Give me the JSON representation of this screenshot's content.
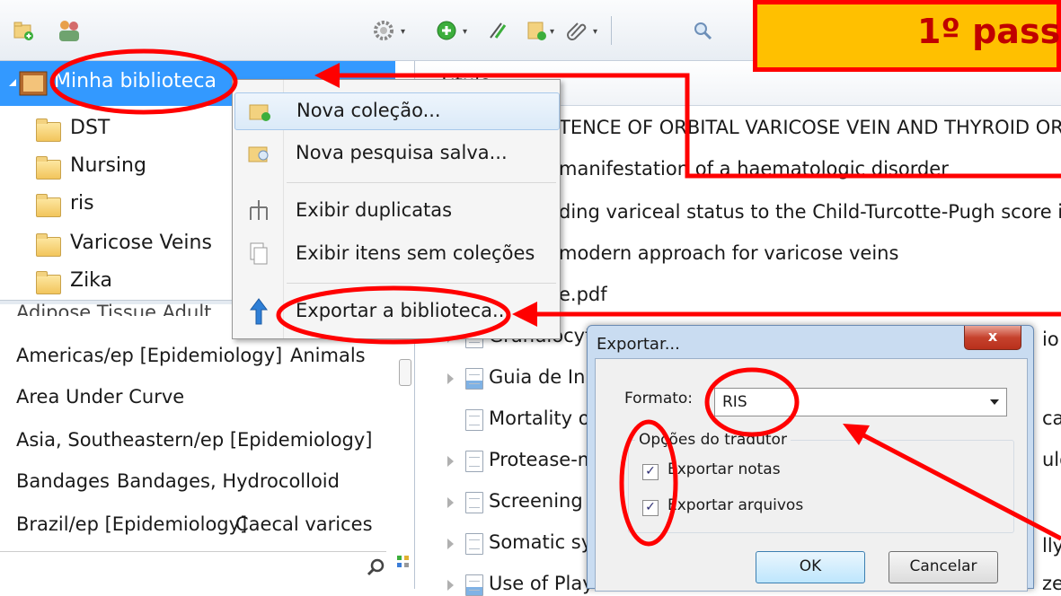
{
  "toolbar": {
    "icons": [
      "new-collection-icon",
      "new-group-icon",
      "actions-gear-icon",
      "add-item-icon",
      "add-by-identifier-icon",
      "new-note-icon",
      "attachment-icon",
      "search-icon"
    ]
  },
  "banner": {
    "text": "1º pass"
  },
  "library": {
    "root": "Minha biblioteca",
    "collections": [
      "DST",
      "Nursing",
      "ris",
      "Varicose Veins",
      "Zika"
    ]
  },
  "tags": {
    "cut_row": "Adipose Tissue   Adult",
    "rows": [
      [
        "Americas/ep [Epidemiology]",
        "Animals"
      ],
      [
        "Area Under Curve"
      ],
      [
        "Asia, Southeastern/ep [Epidemiology]"
      ],
      [
        "Bandages",
        "Bandages, Hydrocolloid"
      ],
      [
        "Brazil/ep [Epidemiology]",
        "Caecal varices"
      ]
    ]
  },
  "list": {
    "header": "Título",
    "rows": [
      "TENCE OF ORBITAL VARICOSE VEIN AND THYROID ORBIT",
      "manifestation of a haematologic disorder",
      "ding variceal status to the Child-Turcotte-Pugh score imp",
      "modern approach for varicose veins",
      "e.pdf",
      "Granulocyt",
      "Guia de Iníc",
      "Mortality o",
      "Protease-m",
      "Screening f",
      "Somatic sy",
      "Use of Play"
    ],
    "right_cut": [
      "io:",
      "cau",
      "ulo",
      "lly",
      "ze"
    ]
  },
  "context_menu": {
    "items": [
      {
        "label": "Nova coleção...",
        "icon": "new-collection-icon"
      },
      {
        "label": "Nova pesquisa salva...",
        "icon": "saved-search-icon"
      },
      {
        "label": "Exibir duplicatas",
        "icon": "duplicates-icon"
      },
      {
        "label": "Exibir itens sem coleções",
        "icon": "unfiled-items-icon"
      },
      {
        "label": "Exportar a biblioteca...",
        "icon": "export-arrow-icon"
      }
    ]
  },
  "dialog": {
    "title": "Exportar...",
    "close": "x",
    "format_label": "Formato:",
    "format_value": "RIS",
    "options_legend": "Opções do tradutor",
    "export_notes": "Exportar notas",
    "export_files": "Exportar arquivos",
    "ok": "OK",
    "cancel": "Cancelar"
  },
  "colors": {
    "annotation_red": "#ff0000",
    "banner_fill": "#ffc000",
    "banner_text": "#c00000",
    "selection": "#3399ff"
  }
}
